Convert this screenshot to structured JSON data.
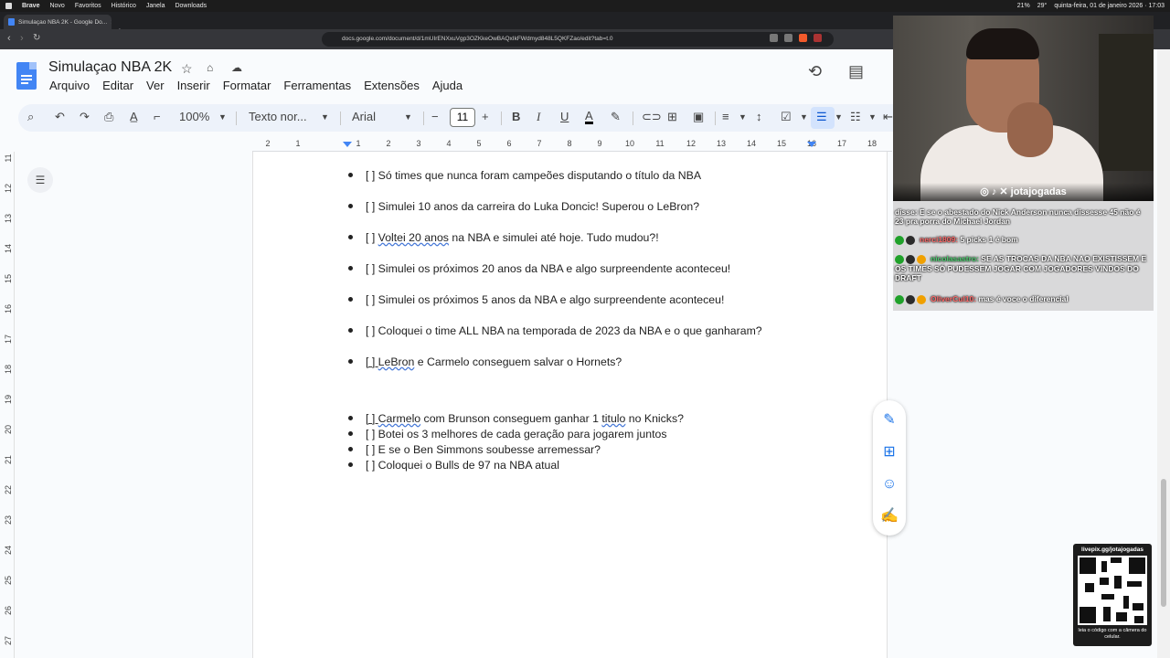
{
  "os_menu": {
    "app": "Brave",
    "items": [
      "Novo",
      "Favoritos",
      "Histórico",
      "Janela",
      "Downloads"
    ],
    "battery": "21%",
    "weather": "29°",
    "datetime": "quinta-feira, 01 de janeiro 2026 · 17:03"
  },
  "browser": {
    "tab_title": "Simulaçao NBA 2K - Google Do...",
    "tab_close": "×",
    "new_tab": "+",
    "url": "docs.google.com/document/d/1mUIrENXxuVgp3OZKkeOwBAQxIkFWdmyd848L5QKFZao/edit?tab=t.0"
  },
  "docs": {
    "title": "Simulaçao NBA 2K",
    "menu": [
      "Arquivo",
      "Editar",
      "Ver",
      "Inserir",
      "Formatar",
      "Ferramentas",
      "Extensões",
      "Ajuda"
    ],
    "toolbar": {
      "zoom": "100%",
      "style": "Texto nor...",
      "font": "Arial",
      "font_size": "11",
      "minus": "−",
      "plus": "+",
      "bold": "B",
      "italic": "I",
      "underline": "U",
      "text_color": "A"
    },
    "ruler_ticks": [
      "2",
      "1",
      "1",
      "2",
      "3",
      "4",
      "5",
      "6",
      "7",
      "8",
      "9",
      "10",
      "11",
      "12",
      "13",
      "14",
      "15",
      "16",
      "17",
      "18"
    ],
    "vruler_ticks": [
      "11",
      "12",
      "13",
      "14",
      "15",
      "16",
      "17",
      "18",
      "19",
      "20",
      "21",
      "22",
      "23",
      "24",
      "25",
      "26",
      "27"
    ]
  },
  "document_items": [
    {
      "prefix": "[ ] ",
      "text": "Só times que nunca foram campeões disputando o título da NBA"
    },
    {
      "prefix": "[ ] ",
      "text": "Simulei 10 anos da carreira do Luka Doncic! Superou o LeBron?"
    },
    {
      "prefix": "[ ] ",
      "underlined": "Voltei 20 anos",
      "text": " na NBA e simulei até hoje. Tudo mudou?!"
    },
    {
      "prefix": "[ ] ",
      "text": "Simulei os próximos 20 anos da NBA e algo surpreendente aconteceu!"
    },
    {
      "prefix": "[ ] ",
      "text": "Simulei os próximos 5 anos da NBA e algo surpreendente aconteceu!"
    },
    {
      "prefix": "[ ] ",
      "text": "Coloquei o time ALL NBA na temporada de 2023 da NBA e o que ganharam?"
    },
    {
      "prefix": "[ ] ",
      "underlined": "LeBron",
      "text": " e Carmelo conseguem salvar o Hornets?"
    },
    {
      "prefix": "[ ] ",
      "underlined": "Carmelo",
      "text": " com Brunson conseguem ganhar 1 ",
      "underlined2": "titulo",
      "text2": " no Knicks?"
    },
    {
      "prefix": "[ ] ",
      "text": "Botei os 3 melhores de cada geração para jogarem juntos"
    },
    {
      "prefix": "[ ] ",
      "text": "E se o Ben Simmons soubesse arremessar?"
    },
    {
      "prefix": "[ ] ",
      "text": "Coloquei o Bulls de 97 na NBA atual"
    }
  ],
  "stream": {
    "handle": "jotajogadas",
    "chat": [
      {
        "user": "",
        "text": "disse: E se o abestado do Nick Anderson nunca dissesse 45 não é 23 pra porra do Michael Jordan"
      },
      {
        "user": "nerci1809:",
        "text": "5 picks 1 é bom"
      },
      {
        "user": "nicolasastro:",
        "text": "SE AS TROCAS DA NBA NAO EXISTISSEM E OS TIMES SÓ PUDESSEM JOGAR COM JOGADORES VINDOS DO DRAFT"
      },
      {
        "user": "OliverCul10:",
        "text": "mas é voce o diferencial"
      }
    ],
    "qr_top": "livepix.gg/jotajogadas",
    "qr_bottom": "leia o código com a câmera do celular."
  }
}
